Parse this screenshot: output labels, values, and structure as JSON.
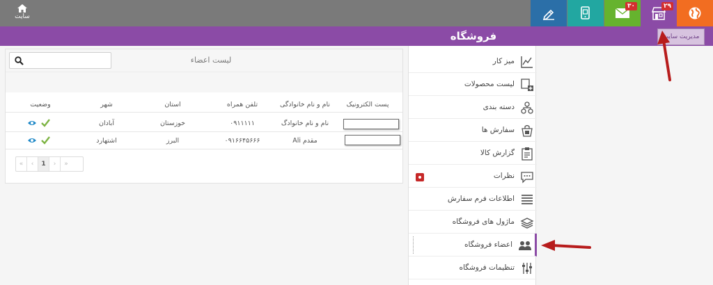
{
  "topbar": {
    "site_label": "سایت",
    "tiles": [
      {
        "name": "edit-tile",
        "color": "#2b6fa8",
        "badge": ""
      },
      {
        "name": "mobile-tile",
        "color": "#22a7a1",
        "badge": ""
      },
      {
        "name": "mail-tile",
        "color": "#66b32e",
        "badge": "۳۰"
      },
      {
        "name": "store-tile",
        "color": "#8b4ba6",
        "badge": "۲۹"
      },
      {
        "name": "globe-tile",
        "color": "#f26d21",
        "badge": ""
      }
    ]
  },
  "header": {
    "store_title": "فروشگاه",
    "admin_tooltip": "مدیریت سایت"
  },
  "sidebar": {
    "items": [
      {
        "label": "میز کار",
        "icon": "chart-icon"
      },
      {
        "label": "لیست محصولات",
        "icon": "product-add-icon"
      },
      {
        "label": "دسته بندی",
        "icon": "category-icon"
      },
      {
        "label": "سفارش ها",
        "icon": "orders-icon"
      },
      {
        "label": "گزارش کالا",
        "icon": "report-icon"
      },
      {
        "label": "نظرات",
        "icon": "comment-icon"
      },
      {
        "label": "اطلاعات فرم سفارش",
        "icon": "list-icon"
      },
      {
        "label": "ماژول های فروشگاه",
        "icon": "modules-icon"
      },
      {
        "label": "اعضاء فروشگاه",
        "icon": "members-icon"
      },
      {
        "label": "تنظیمات فروشگاه",
        "icon": "settings-icon"
      }
    ]
  },
  "members": {
    "title": "لیست اعضاء",
    "search": {
      "placeholder": "",
      "value": ""
    },
    "columns": {
      "email": "پست الکترونیک",
      "name": "نام و نام خانوادگی",
      "phone": "تلفن همراه",
      "province": "استان",
      "city": "شهر",
      "status": "وضعیت"
    },
    "rows": [
      {
        "email": "",
        "name": "نام و نام خانوادگ",
        "phone": "۰۹۱۱۱۱۱",
        "province": "خوزستان",
        "city": "آبادان"
      },
      {
        "email": "",
        "name": "Ali مقدم",
        "phone": "۰۹۱۶۶۴۵۶۶۶",
        "province": "البرز",
        "city": "اشتهارد"
      }
    ],
    "pager": {
      "first": "«",
      "prev": "‹",
      "current": "1",
      "next": "›",
      "last": "»"
    }
  },
  "colors": {
    "accent": "#8b4ba6",
    "topbar": "#7a7a7a",
    "check": "#7cb342",
    "eye": "#1e88c7",
    "arrow": "#b71c1c"
  }
}
